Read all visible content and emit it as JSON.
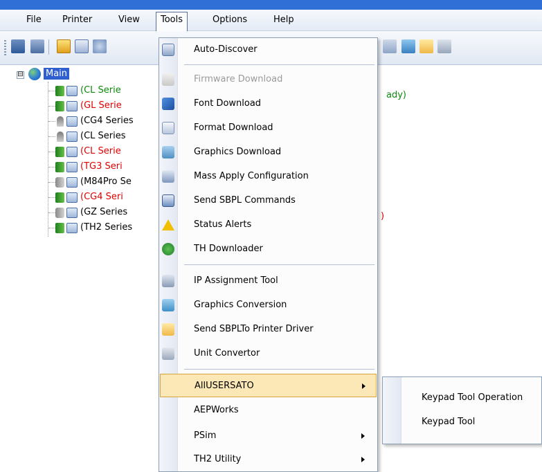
{
  "menubar": {
    "items": [
      "File",
      "Printer",
      "View",
      "Tools",
      "Options",
      "Help"
    ],
    "open_index": 3
  },
  "tree": {
    "root_label": "Main",
    "expander": "⊟",
    "nodes": [
      {
        "text": "(CL Serie",
        "color": "green",
        "icon": "green-adapter-icon"
      },
      {
        "text": "(GL Serie",
        "color": "red",
        "icon": "green-adapter-icon"
      },
      {
        "text": "(CG4 Series",
        "color": "ok",
        "icon": "usb-icon"
      },
      {
        "text": "(CL Series",
        "color": "ok",
        "icon": "usb-icon"
      },
      {
        "text": "(CL Serie",
        "color": "red",
        "icon": "green-adapter-icon"
      },
      {
        "text": "(TG3 Seri",
        "color": "red",
        "icon": "green-adapter-icon"
      },
      {
        "text": "(M84Pro Se",
        "color": "ok",
        "icon": "gray-adapter-icon"
      },
      {
        "text": "(CG4 Seri",
        "color": "red",
        "icon": "green-adapter-icon"
      },
      {
        "text": "(GZ Series",
        "color": "ok",
        "icon": "gray-adapter-icon"
      },
      {
        "text": "(TH2 Series",
        "color": "ok",
        "icon": "green-adapter-icon"
      }
    ],
    "behind_text_1": "ady)",
    "behind_text_2": ")"
  },
  "tools_menu": {
    "items": [
      {
        "label": "Auto-Discover",
        "icon": "auto-discover-icon",
        "enabled": true
      },
      {
        "label": "Firmware Download",
        "icon": "firmware-download-icon",
        "enabled": false
      },
      {
        "label": "Font Download",
        "icon": "font-download-icon",
        "enabled": true
      },
      {
        "label": "Format Download",
        "icon": "format-download-icon",
        "enabled": true
      },
      {
        "label": "Graphics Download",
        "icon": "graphics-download-icon",
        "enabled": true
      },
      {
        "label": "Mass Apply Configuration",
        "icon": "mass-apply-icon",
        "enabled": true
      },
      {
        "label": "Send SBPL Commands",
        "icon": "send-sbpl-icon",
        "enabled": true
      },
      {
        "label": "Status Alerts",
        "icon": "warning-icon",
        "enabled": true
      },
      {
        "label": "TH Downloader",
        "icon": "aep-icon",
        "enabled": true
      },
      {
        "label": "IP Assignment Tool",
        "icon": "ip-assignment-icon",
        "enabled": true
      },
      {
        "label": "Graphics Conversion",
        "icon": "graphics-conversion-icon",
        "enabled": true
      },
      {
        "label": "Send SBPLTo Printer Driver",
        "icon": "folder-icon",
        "enabled": true
      },
      {
        "label": "Unit Convertor",
        "icon": "calculator-icon",
        "enabled": true
      },
      {
        "label": "AllUSERSATO",
        "submenu": true,
        "highlighted": true
      },
      {
        "label": "AEPWorks"
      },
      {
        "label": "PSim",
        "submenu": true
      },
      {
        "label": "TH2 Utility",
        "submenu": true
      }
    ]
  },
  "submenu": {
    "items": [
      "Keypad Tool Operation",
      "Keypad Tool"
    ]
  },
  "colors": {
    "highlight_bg": "#fbe8b6",
    "highlight_border": "#d8a33b",
    "tree_selected": "#2f5fcf",
    "green_text": "#0a8a0a",
    "red_text": "#e00000"
  }
}
